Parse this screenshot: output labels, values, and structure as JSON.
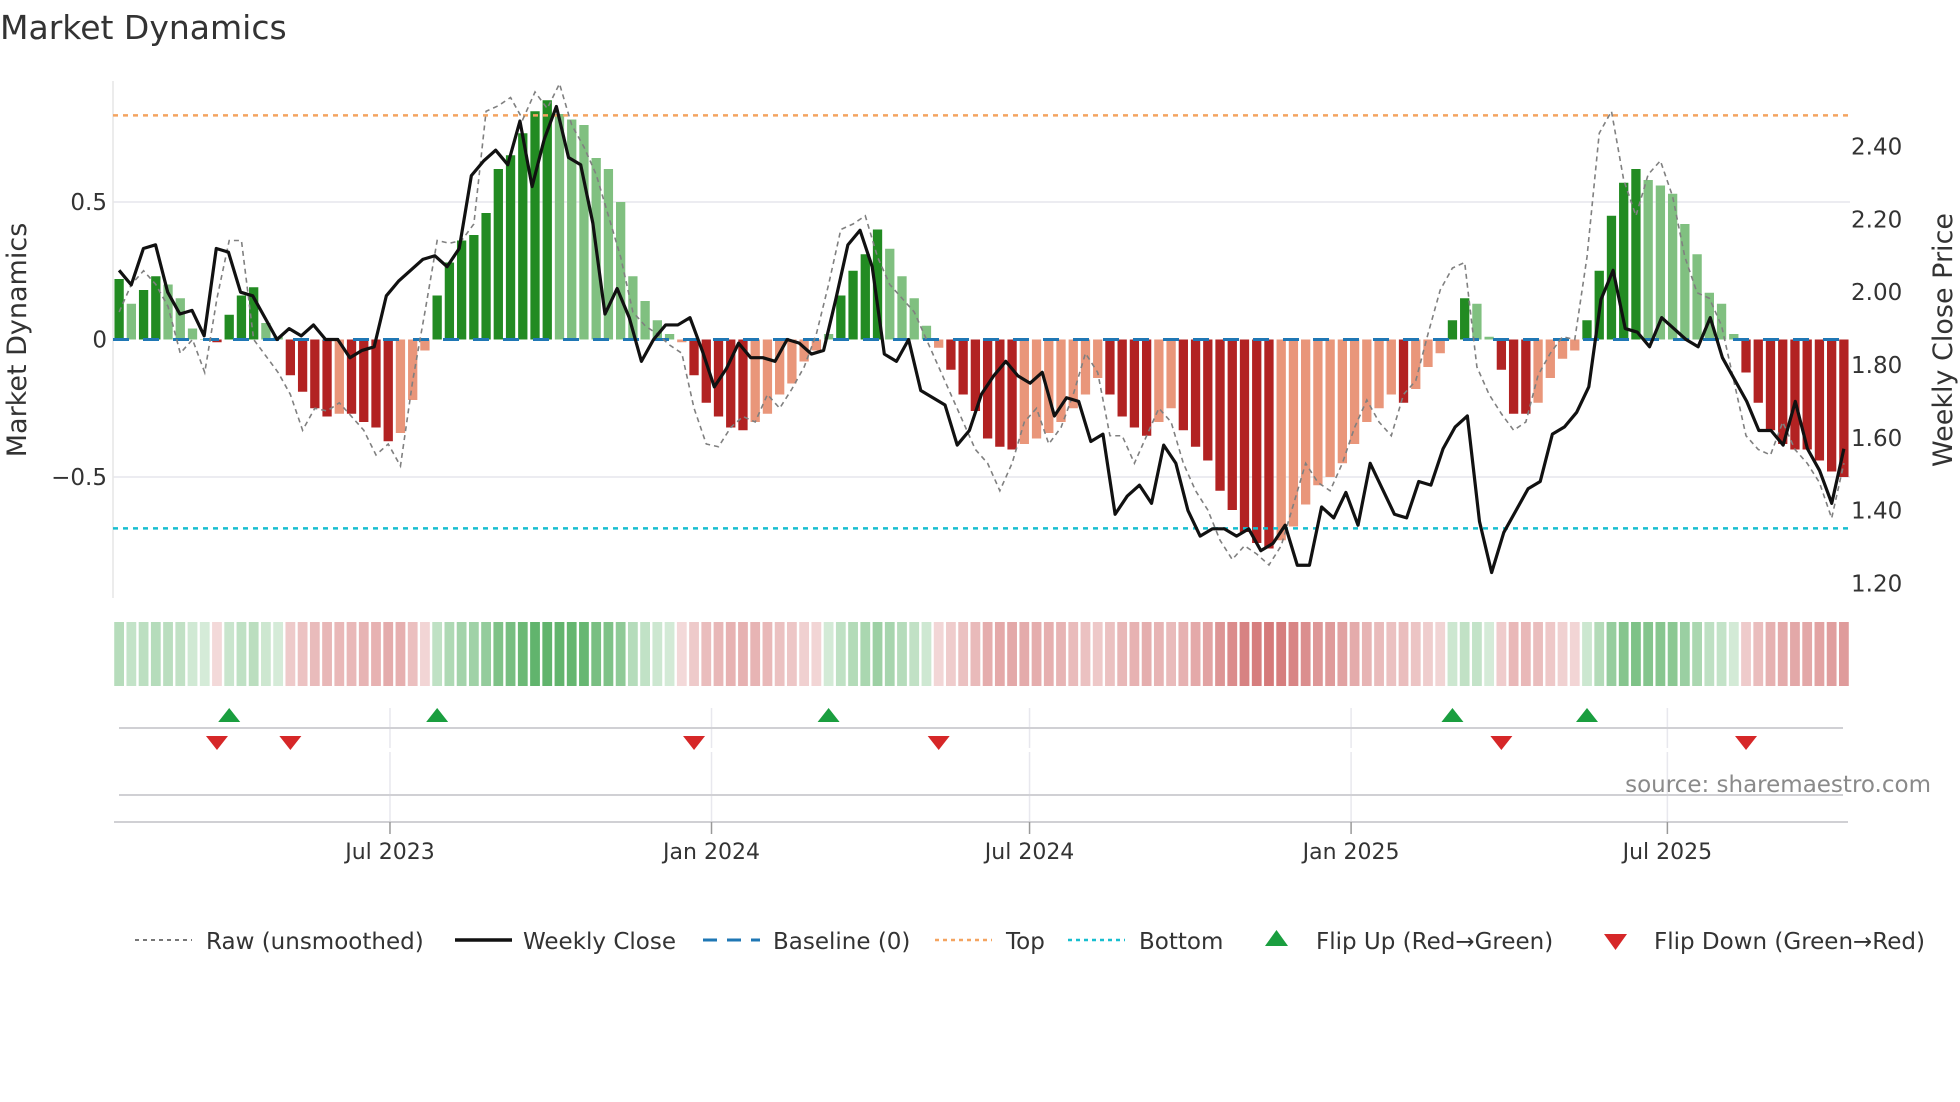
{
  "title": "Market Dynamics",
  "source": "source: sharemaestro.com",
  "colors": {
    "green_strong": "#228b22",
    "green_weak": "#80c080",
    "red_strong": "#b22222",
    "red_weak": "#e9967a",
    "baseline": "#1f77b4",
    "top": "#f4a460",
    "bottom": "#17becf",
    "flip_up": "#1a9e3f",
    "flip_down": "#d62728"
  },
  "chart_data": {
    "type": "bar",
    "title": "Market Dynamics",
    "ylabel": "Market Dynamics",
    "y2label": "Weekly Close Price",
    "ylim": [
      -0.94,
      0.94
    ],
    "y2lim": [
      1.16,
      2.58
    ],
    "yticks": [
      {
        "v": 0.5,
        "label": "0.5"
      },
      {
        "v": 0,
        "label": "0"
      },
      {
        "v": -0.5,
        "label": "−0.5"
      }
    ],
    "y2ticks": [
      {
        "v": 2.4,
        "label": "2.40"
      },
      {
        "v": 2.2,
        "label": "2.20"
      },
      {
        "v": 2.0,
        "label": "2.00"
      },
      {
        "v": 1.8,
        "label": "1.80"
      },
      {
        "v": 1.6,
        "label": "1.60"
      },
      {
        "v": 1.4,
        "label": "1.40"
      },
      {
        "v": 1.2,
        "label": "1.20"
      }
    ],
    "start_date": "2023-01-27",
    "interval": "weekly",
    "xticks": [
      {
        "date": "2023-07-01",
        "label": "Jul 2023"
      },
      {
        "date": "2024-01-01",
        "label": "Jan 2024"
      },
      {
        "date": "2024-07-01",
        "label": "Jul 2024"
      },
      {
        "date": "2025-01-01",
        "label": "Jan 2025"
      },
      {
        "date": "2025-07-01",
        "label": "Jul 2025"
      }
    ],
    "top_level": 0.815,
    "bottom_level": -0.687,
    "baseline": 0,
    "values": [
      0.22,
      0.13,
      0.18,
      0.23,
      0.2,
      0.15,
      0.04,
      0.0,
      -0.01,
      0.09,
      0.16,
      0.19,
      0.06,
      0.01,
      -0.13,
      -0.19,
      -0.25,
      -0.28,
      -0.27,
      -0.27,
      -0.3,
      -0.32,
      -0.37,
      -0.34,
      -0.22,
      -0.04,
      0.16,
      0.28,
      0.36,
      0.38,
      0.46,
      0.62,
      0.67,
      0.75,
      0.83,
      0.87,
      0.82,
      0.8,
      0.78,
      0.66,
      0.62,
      0.5,
      0.23,
      0.14,
      0.07,
      0.02,
      -0.01,
      -0.13,
      -0.23,
      -0.28,
      -0.32,
      -0.33,
      -0.3,
      -0.27,
      -0.2,
      -0.16,
      -0.08,
      -0.04,
      0.02,
      0.16,
      0.25,
      0.31,
      0.4,
      0.33,
      0.23,
      0.15,
      0.05,
      -0.03,
      -0.11,
      -0.2,
      -0.26,
      -0.36,
      -0.39,
      -0.4,
      -0.38,
      -0.36,
      -0.34,
      -0.3,
      -0.25,
      -0.2,
      -0.14,
      -0.2,
      -0.28,
      -0.32,
      -0.35,
      -0.3,
      -0.25,
      -0.33,
      -0.39,
      -0.44,
      -0.55,
      -0.62,
      -0.7,
      -0.74,
      -0.76,
      -0.73,
      -0.68,
      -0.6,
      -0.53,
      -0.5,
      -0.45,
      -0.38,
      -0.3,
      -0.25,
      -0.2,
      -0.23,
      -0.18,
      -0.1,
      -0.05,
      0.07,
      0.15,
      0.13,
      0.01,
      -0.11,
      -0.27,
      -0.27,
      -0.23,
      -0.14,
      -0.07,
      -0.04,
      0.07,
      0.25,
      0.45,
      0.57,
      0.62,
      0.58,
      0.56,
      0.53,
      0.42,
      0.31,
      0.17,
      0.13,
      0.02,
      -0.12,
      -0.23,
      -0.33,
      -0.38,
      -0.4,
      -0.4,
      -0.44,
      -0.48,
      -0.5
    ],
    "raw": [
      0.1,
      0.2,
      0.25,
      0.2,
      0.12,
      -0.05,
      0.0,
      -0.12,
      0.15,
      0.36,
      0.36,
      0.0,
      -0.06,
      -0.12,
      -0.2,
      -0.33,
      -0.25,
      -0.26,
      -0.23,
      -0.28,
      -0.33,
      -0.42,
      -0.38,
      -0.46,
      -0.15,
      0.1,
      0.36,
      0.35,
      0.36,
      0.42,
      0.83,
      0.85,
      0.88,
      0.8,
      0.9,
      0.84,
      0.93,
      0.78,
      0.7,
      0.6,
      0.45,
      0.3,
      0.1,
      0.05,
      0.02,
      -0.02,
      -0.05,
      -0.25,
      -0.38,
      -0.39,
      -0.32,
      -0.28,
      -0.3,
      -0.2,
      -0.25,
      -0.18,
      -0.1,
      0.02,
      0.2,
      0.4,
      0.42,
      0.45,
      0.3,
      0.2,
      0.15,
      0.1,
      0.0,
      -0.1,
      -0.2,
      -0.3,
      -0.4,
      -0.45,
      -0.55,
      -0.45,
      -0.3,
      -0.25,
      -0.38,
      -0.32,
      -0.2,
      -0.05,
      -0.12,
      -0.35,
      -0.35,
      -0.45,
      -0.35,
      -0.25,
      -0.3,
      -0.45,
      -0.55,
      -0.62,
      -0.73,
      -0.8,
      -0.75,
      -0.78,
      -0.82,
      -0.75,
      -0.6,
      -0.45,
      -0.52,
      -0.55,
      -0.45,
      -0.32,
      -0.22,
      -0.3,
      -0.35,
      -0.2,
      -0.15,
      0.02,
      0.18,
      0.26,
      0.28,
      -0.1,
      -0.2,
      -0.27,
      -0.33,
      -0.3,
      -0.13,
      -0.05,
      0.01,
      0.0,
      0.3,
      0.75,
      0.83,
      0.58,
      0.45,
      0.6,
      0.65,
      0.52,
      0.3,
      0.17,
      0.15,
      0.05,
      -0.15,
      -0.35,
      -0.4,
      -0.42,
      -0.3,
      -0.4,
      -0.45,
      -0.52,
      -0.65,
      -0.45
    ],
    "weekly_close": [
      2.06,
      2.02,
      2.12,
      2.13,
      2.0,
      1.94,
      1.95,
      1.88,
      2.12,
      2.11,
      2.0,
      1.99,
      1.93,
      1.87,
      1.9,
      1.88,
      1.91,
      1.87,
      1.87,
      1.82,
      1.84,
      1.85,
      1.99,
      2.03,
      2.06,
      2.09,
      2.1,
      2.07,
      2.12,
      2.32,
      2.36,
      2.39,
      2.35,
      2.47,
      2.29,
      2.42,
      2.51,
      2.37,
      2.35,
      2.19,
      1.94,
      2.01,
      1.93,
      1.81,
      1.87,
      1.91,
      1.91,
      1.93,
      1.84,
      1.74,
      1.79,
      1.86,
      1.82,
      1.82,
      1.81,
      1.87,
      1.86,
      1.83,
      1.84,
      1.98,
      2.13,
      2.17,
      2.07,
      1.83,
      1.81,
      1.87,
      1.73,
      1.71,
      1.69,
      1.58,
      1.62,
      1.72,
      1.77,
      1.81,
      1.77,
      1.75,
      1.78,
      1.66,
      1.71,
      1.7,
      1.59,
      1.61,
      1.39,
      1.44,
      1.47,
      1.42,
      1.58,
      1.53,
      1.4,
      1.33,
      1.35,
      1.35,
      1.33,
      1.35,
      1.29,
      1.31,
      1.36,
      1.25,
      1.25,
      1.41,
      1.38,
      1.45,
      1.36,
      1.53,
      1.46,
      1.39,
      1.38,
      1.48,
      1.47,
      1.57,
      1.63,
      1.66,
      1.37,
      1.23,
      1.34,
      1.4,
      1.46,
      1.48,
      1.61,
      1.63,
      1.67,
      1.74,
      1.98,
      2.06,
      1.9,
      1.89,
      1.85,
      1.93,
      1.9,
      1.87,
      1.85,
      1.93,
      1.82,
      1.76,
      1.7,
      1.62,
      1.62,
      1.58,
      1.7,
      1.57,
      1.51,
      1.42,
      1.57
    ],
    "flip_up": [
      "2023-03-31",
      "2023-07-28",
      "2024-03-08",
      "2025-02-28",
      "2025-05-16"
    ],
    "flip_down": [
      "2023-03-24",
      "2023-05-05",
      "2023-12-22",
      "2024-05-10",
      "2025-03-28",
      "2025-08-15"
    ],
    "legend": {
      "placement": "bottom",
      "raw": "Raw (unsmoothed)",
      "close": "Weekly Close",
      "baseline": "Baseline (0)",
      "top": "Top",
      "bottom": "Bottom",
      "flip_up": "Flip Up (Red→Green)",
      "flip_down": "Flip Down (Green→Red)"
    }
  }
}
